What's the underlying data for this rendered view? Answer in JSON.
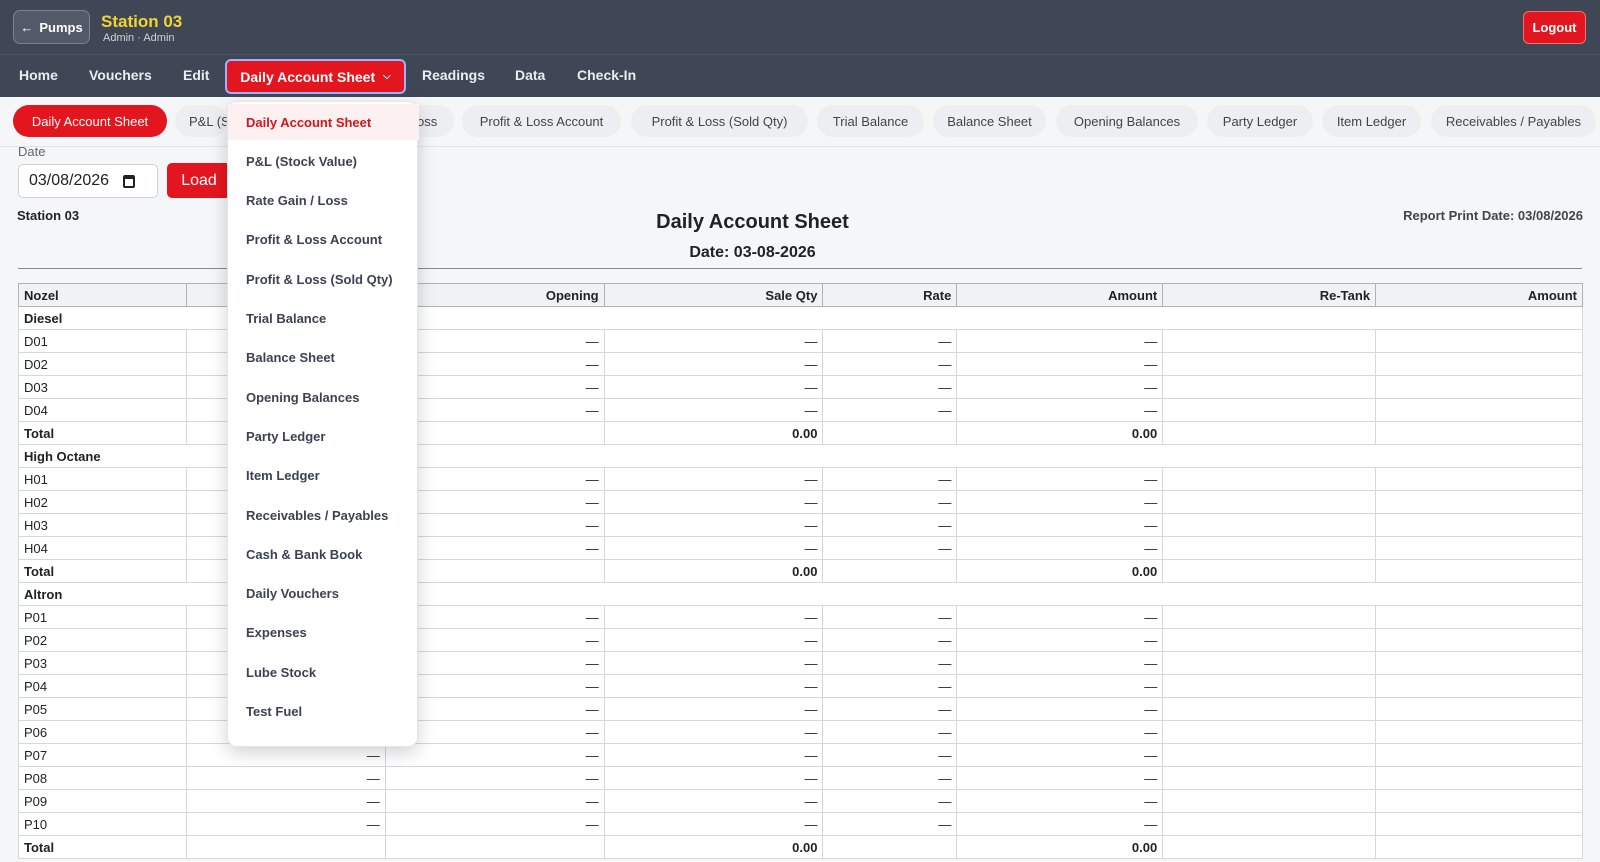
{
  "header": {
    "back_label": "Pumps",
    "station_title": "Station 03",
    "station_sub": "Admin · Admin",
    "logout_label": "Logout"
  },
  "nav": {
    "home": "Home",
    "vouchers": "Vouchers",
    "edit": "Edit",
    "active": "Daily Account Sheet",
    "readings": "Readings",
    "data": "Data",
    "checkin": "Check-In"
  },
  "pills": [
    "Daily Account Sheet",
    "P&L (S",
    "oss",
    "Profit & Loss Account",
    "Profit & Loss (Sold Qty)",
    "Trial Balance",
    "Balance Sheet",
    "Opening Balances",
    "Party Ledger",
    "Item Ledger",
    "Receivables / Payables"
  ],
  "form": {
    "date_label": "Date",
    "date_value": "03/08/2026",
    "load_label": "Load"
  },
  "report": {
    "station": "Station 03",
    "title": "Daily Account Sheet",
    "date_line": "Date: 03-08-2026",
    "print_date": "Report Print Date: 03/08/2026"
  },
  "table": {
    "headers": [
      "Nozel",
      "",
      "Opening",
      "Sale Qty",
      "Rate",
      "Amount",
      "Re-Tank",
      "Amount"
    ],
    "groups": [
      {
        "name": "Diesel",
        "rows": [
          [
            "D01",
            "",
            "—",
            "—",
            "—",
            "—",
            "",
            ""
          ],
          [
            "D02",
            "",
            "—",
            "—",
            "—",
            "—",
            "",
            ""
          ],
          [
            "D03",
            "",
            "—",
            "—",
            "—",
            "—",
            "",
            ""
          ],
          [
            "D04",
            "",
            "—",
            "—",
            "—",
            "—",
            "",
            ""
          ]
        ],
        "total": [
          "Total",
          "",
          "",
          "0.00",
          "",
          "0.00",
          "",
          ""
        ]
      },
      {
        "name": "High Octane",
        "rows": [
          [
            "H01",
            "",
            "—",
            "—",
            "—",
            "—",
            "",
            ""
          ],
          [
            "H02",
            "",
            "—",
            "—",
            "—",
            "—",
            "",
            ""
          ],
          [
            "H03",
            "",
            "—",
            "—",
            "—",
            "—",
            "",
            ""
          ],
          [
            "H04",
            "",
            "—",
            "—",
            "—",
            "—",
            "",
            ""
          ]
        ],
        "total": [
          "Total",
          "",
          "",
          "0.00",
          "",
          "0.00",
          "",
          ""
        ]
      },
      {
        "name": "Altron",
        "rows": [
          [
            "P01",
            "",
            "—",
            "—",
            "—",
            "—",
            "",
            ""
          ],
          [
            "P02",
            "",
            "—",
            "—",
            "—",
            "—",
            "",
            ""
          ],
          [
            "P03",
            "",
            "—",
            "—",
            "—",
            "—",
            "",
            ""
          ],
          [
            "P04",
            "",
            "—",
            "—",
            "—",
            "—",
            "",
            ""
          ],
          [
            "P05",
            "",
            "—",
            "—",
            "—",
            "—",
            "",
            ""
          ],
          [
            "P06",
            "",
            "—",
            "—",
            "—",
            "—",
            "",
            ""
          ],
          [
            "P07",
            "—",
            "—",
            "—",
            "—",
            "—",
            "",
            ""
          ],
          [
            "P08",
            "—",
            "—",
            "—",
            "—",
            "—",
            "",
            ""
          ],
          [
            "P09",
            "—",
            "—",
            "—",
            "—",
            "—",
            "",
            ""
          ],
          [
            "P10",
            "—",
            "—",
            "—",
            "—",
            "—",
            "",
            ""
          ]
        ],
        "total": [
          "Total",
          "",
          "",
          "0.00",
          "",
          "0.00",
          "",
          ""
        ]
      }
    ]
  },
  "dropdown": [
    "Daily Account Sheet",
    "P&L (Stock Value)",
    "Rate Gain / Loss",
    "Profit & Loss Account",
    "Profit & Loss (Sold Qty)",
    "Trial Balance",
    "Balance Sheet",
    "Opening Balances",
    "Party Ledger",
    "Item Ledger",
    "Receivables / Payables",
    "Cash & Bank Book",
    "Daily Vouchers",
    "Expenses",
    "Lube Stock",
    "Test Fuel"
  ],
  "colors": {
    "topbar": "#3f4756",
    "accent": "#e3161f",
    "station_title": "#f2d431"
  }
}
